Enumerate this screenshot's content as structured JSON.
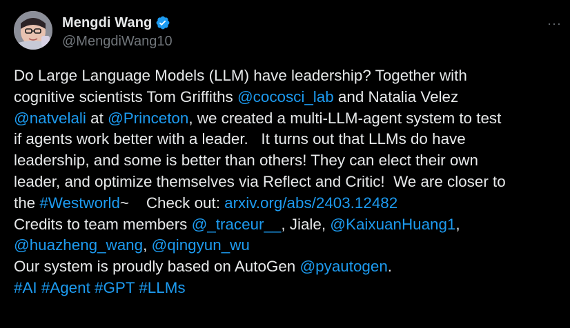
{
  "author": {
    "display_name": "Mengdi Wang",
    "handle": "@MengdiWang10",
    "verified_icon": "verified-badge-icon"
  },
  "menu": {
    "more_label": "···"
  },
  "colors": {
    "background": "#000000",
    "text": "#e7e9ea",
    "secondary": "#71767b",
    "link": "#1d9bf0"
  },
  "tweet": {
    "l1": "Do Large Language Models (LLM) have leadership? Together with",
    "l2a": "cognitive scientists Tom Griffiths ",
    "l2b": "@cocosci_lab",
    "l2c": " and Natalia Velez",
    "l3a": "@natvelali",
    "l3b": " at ",
    "l3c": "@Princeton",
    "l3d": ", we created a multi-LLM-agent system to test",
    "l4": "if agents work better with a leader.   It turns out that LLMs do have",
    "l5": "leadership, and some is better than others! They can elect their own",
    "l6": "leader, and optimize themselves via Reflect and Critic!  We are closer to",
    "l7a": "the ",
    "l7b": "#Westworld",
    "l7c": "~    Check out: ",
    "l7d": "arxiv.org/abs/2403.12482",
    "l8a": "Credits to team members ",
    "l8b": "@_traceur__",
    "l8c": ", Jiale, ",
    "l8d": "@KaixuanHuang1",
    "l8e": ",",
    "l9a": "@huazheng_wang",
    "l9b": ", ",
    "l9c": "@qingyun_wu",
    "l10a": "Our system is proudly based on AutoGen ",
    "l10b": "@pyautogen",
    "l10c": ".",
    "l11a": "#AI",
    "l11b": " ",
    "l11c": "#Agent",
    "l11d": " ",
    "l11e": "#GPT",
    "l11f": " ",
    "l11g": "#LLMs"
  }
}
